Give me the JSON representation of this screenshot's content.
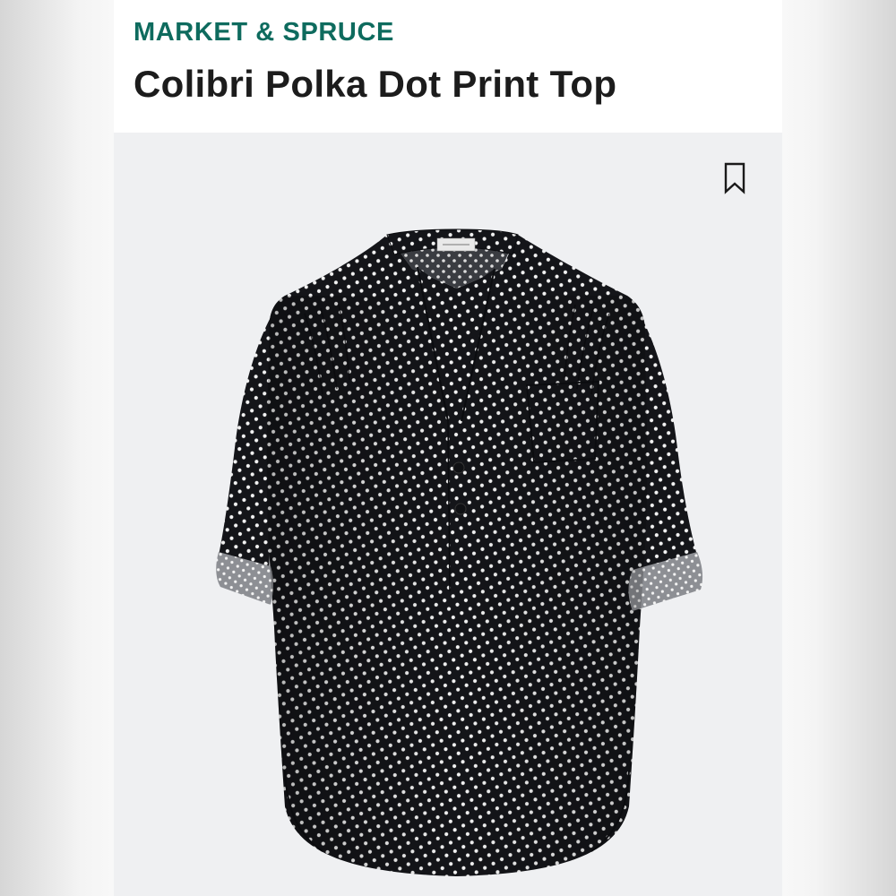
{
  "product": {
    "brand": "MARKET & SPRUCE",
    "title": "Colibri Polka Dot Print Top"
  },
  "icons": {
    "bookmark": "bookmark-icon"
  },
  "image": {
    "subject": "black-and-white polka dot blouse"
  },
  "colors": {
    "brand": "#0e6b5e",
    "title": "#1c1c1c",
    "image_background": "#eff0f2",
    "garment": "#141519",
    "dots": "#ffffff"
  }
}
